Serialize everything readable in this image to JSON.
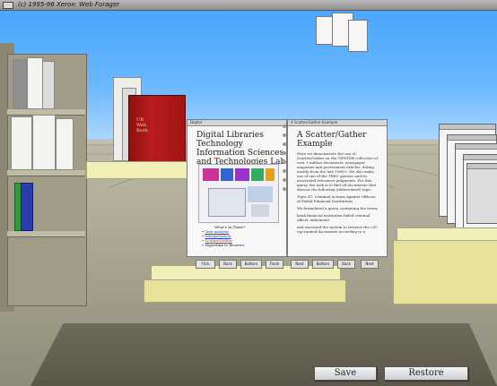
{
  "window": {
    "title": "(c) 1995-96 Xerox:  Web Forager"
  },
  "red_book": {
    "title_lines": [
      "UR",
      "Web",
      "Book"
    ]
  },
  "open_book": {
    "left_page": {
      "header": "Digital",
      "title": "Digital Libraries Technology Information Sciences and Technologies Lab",
      "section": "What's In There?",
      "links": [
        "Text Analysis",
        "Interpretation",
        "Scatter/Gather",
        "Hyperlink to Browser"
      ]
    },
    "right_page": {
      "header": "A Scatter/Gather Example",
      "title": "A Scatter/Gather Example",
      "body": [
        "Here we demonstrate the use of Scatter/Gather on the TIPSTER collection of over 1 million documents, newspaper magazine and government articles, dating mostly from the late 1980's. We also make use of one of the TREC queries and its associated relevance judgments. For this query, the task is to find all documents that discuss the following (abbreviated) topic:",
        "Topic 47: Criminal Actions Against Officers of Failed Financial Institutions",
        "We formulated a query containing the terms",
        "bank financial institution failed criminal officer indictment",
        "and executed the system to retrieve the 250 top-ranked documents according to a"
      ]
    },
    "nav_buttons": [
      "Flick",
      "Back",
      "Bottom",
      "Flash",
      "Next",
      "Bottom",
      "Back",
      "Next"
    ]
  },
  "controls": {
    "save_label": "Save",
    "restore_label": "Restore"
  },
  "colors": {
    "sky_top": "#4aa6ff",
    "floor": "#a9a592",
    "book_red": "#b81d1d",
    "pedestal": "#f2efb8"
  }
}
